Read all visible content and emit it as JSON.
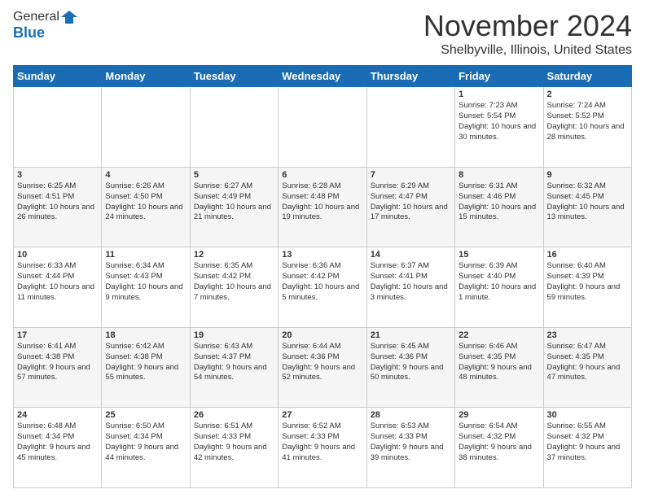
{
  "header": {
    "logo_general": "General",
    "logo_blue": "Blue",
    "month_title": "November 2024",
    "location": "Shelbyville, Illinois, United States"
  },
  "days_of_week": [
    "Sunday",
    "Monday",
    "Tuesday",
    "Wednesday",
    "Thursday",
    "Friday",
    "Saturday"
  ],
  "weeks": [
    [
      {
        "day": "",
        "info": ""
      },
      {
        "day": "",
        "info": ""
      },
      {
        "day": "",
        "info": ""
      },
      {
        "day": "",
        "info": ""
      },
      {
        "day": "",
        "info": ""
      },
      {
        "day": "1",
        "info": "Sunrise: 7:23 AM\nSunset: 5:54 PM\nDaylight: 10 hours and 30 minutes."
      },
      {
        "day": "2",
        "info": "Sunrise: 7:24 AM\nSunset: 5:52 PM\nDaylight: 10 hours and 28 minutes."
      }
    ],
    [
      {
        "day": "3",
        "info": "Sunrise: 6:25 AM\nSunset: 4:51 PM\nDaylight: 10 hours and 26 minutes."
      },
      {
        "day": "4",
        "info": "Sunrise: 6:26 AM\nSunset: 4:50 PM\nDaylight: 10 hours and 24 minutes."
      },
      {
        "day": "5",
        "info": "Sunrise: 6:27 AM\nSunset: 4:49 PM\nDaylight: 10 hours and 21 minutes."
      },
      {
        "day": "6",
        "info": "Sunrise: 6:28 AM\nSunset: 4:48 PM\nDaylight: 10 hours and 19 minutes."
      },
      {
        "day": "7",
        "info": "Sunrise: 6:29 AM\nSunset: 4:47 PM\nDaylight: 10 hours and 17 minutes."
      },
      {
        "day": "8",
        "info": "Sunrise: 6:31 AM\nSunset: 4:46 PM\nDaylight: 10 hours and 15 minutes."
      },
      {
        "day": "9",
        "info": "Sunrise: 6:32 AM\nSunset: 4:45 PM\nDaylight: 10 hours and 13 minutes."
      }
    ],
    [
      {
        "day": "10",
        "info": "Sunrise: 6:33 AM\nSunset: 4:44 PM\nDaylight: 10 hours and 11 minutes."
      },
      {
        "day": "11",
        "info": "Sunrise: 6:34 AM\nSunset: 4:43 PM\nDaylight: 10 hours and 9 minutes."
      },
      {
        "day": "12",
        "info": "Sunrise: 6:35 AM\nSunset: 4:42 PM\nDaylight: 10 hours and 7 minutes."
      },
      {
        "day": "13",
        "info": "Sunrise: 6:36 AM\nSunset: 4:42 PM\nDaylight: 10 hours and 5 minutes."
      },
      {
        "day": "14",
        "info": "Sunrise: 6:37 AM\nSunset: 4:41 PM\nDaylight: 10 hours and 3 minutes."
      },
      {
        "day": "15",
        "info": "Sunrise: 6:39 AM\nSunset: 4:40 PM\nDaylight: 10 hours and 1 minute."
      },
      {
        "day": "16",
        "info": "Sunrise: 6:40 AM\nSunset: 4:39 PM\nDaylight: 9 hours and 59 minutes."
      }
    ],
    [
      {
        "day": "17",
        "info": "Sunrise: 6:41 AM\nSunset: 4:38 PM\nDaylight: 9 hours and 57 minutes."
      },
      {
        "day": "18",
        "info": "Sunrise: 6:42 AM\nSunset: 4:38 PM\nDaylight: 9 hours and 55 minutes."
      },
      {
        "day": "19",
        "info": "Sunrise: 6:43 AM\nSunset: 4:37 PM\nDaylight: 9 hours and 54 minutes."
      },
      {
        "day": "20",
        "info": "Sunrise: 6:44 AM\nSunset: 4:36 PM\nDaylight: 9 hours and 52 minutes."
      },
      {
        "day": "21",
        "info": "Sunrise: 6:45 AM\nSunset: 4:36 PM\nDaylight: 9 hours and 50 minutes."
      },
      {
        "day": "22",
        "info": "Sunrise: 6:46 AM\nSunset: 4:35 PM\nDaylight: 9 hours and 48 minutes."
      },
      {
        "day": "23",
        "info": "Sunrise: 6:47 AM\nSunset: 4:35 PM\nDaylight: 9 hours and 47 minutes."
      }
    ],
    [
      {
        "day": "24",
        "info": "Sunrise: 6:48 AM\nSunset: 4:34 PM\nDaylight: 9 hours and 45 minutes."
      },
      {
        "day": "25",
        "info": "Sunrise: 6:50 AM\nSunset: 4:34 PM\nDaylight: 9 hours and 44 minutes."
      },
      {
        "day": "26",
        "info": "Sunrise: 6:51 AM\nSunset: 4:33 PM\nDaylight: 9 hours and 42 minutes."
      },
      {
        "day": "27",
        "info": "Sunrise: 6:52 AM\nSunset: 4:33 PM\nDaylight: 9 hours and 41 minutes."
      },
      {
        "day": "28",
        "info": "Sunrise: 6:53 AM\nSunset: 4:33 PM\nDaylight: 9 hours and 39 minutes."
      },
      {
        "day": "29",
        "info": "Sunrise: 6:54 AM\nSunset: 4:32 PM\nDaylight: 9 hours and 38 minutes."
      },
      {
        "day": "30",
        "info": "Sunrise: 6:55 AM\nSunset: 4:32 PM\nDaylight: 9 hours and 37 minutes."
      }
    ]
  ]
}
